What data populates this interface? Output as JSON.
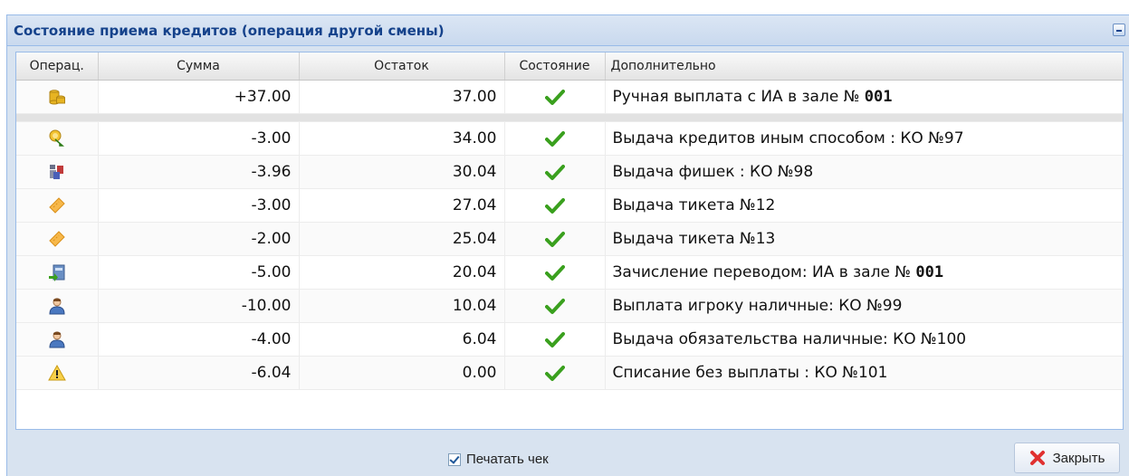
{
  "window": {
    "title": "Состояние приема кредитов (операция другой смены)"
  },
  "table": {
    "columns": {
      "op": "Операц.",
      "sum": "Сумма",
      "rest": "Остаток",
      "state": "Состояние",
      "extra": "Дополнительно"
    },
    "first_row": {
      "icon": "coins-icon",
      "sum": "+37.00",
      "rest": "37.00",
      "state": "success-check-icon",
      "extra_text": "Ручная выплата с ИА в зале № ",
      "extra_bold": "001"
    },
    "rows": [
      {
        "icon": "credit-issue-icon",
        "sum": "-3.00",
        "rest": "34.00",
        "state": "success-check-icon",
        "extra_text": "Выдача кредитов иным способом : КО №97",
        "extra_bold": ""
      },
      {
        "icon": "chips-icon",
        "sum": "-3.96",
        "rest": "30.04",
        "state": "success-check-icon",
        "extra_text": "Выдача фишек : КО №98",
        "extra_bold": ""
      },
      {
        "icon": "ticket-icon",
        "sum": "-3.00",
        "rest": "27.04",
        "state": "success-check-icon",
        "extra_text": "Выдача тикета №12",
        "extra_bold": ""
      },
      {
        "icon": "ticket-icon",
        "sum": "-2.00",
        "rest": "25.04",
        "state": "success-check-icon",
        "extra_text": "Выдача тикета №13",
        "extra_bold": ""
      },
      {
        "icon": "transfer-icon",
        "sum": "-5.00",
        "rest": "20.04",
        "state": "success-check-icon",
        "extra_text": "Зачисление переводом: ИА в зале № ",
        "extra_bold": "001"
      },
      {
        "icon": "user-icon",
        "sum": "-10.00",
        "rest": "10.04",
        "state": "success-check-icon",
        "extra_text": "Выплата игроку наличные: КО №99",
        "extra_bold": ""
      },
      {
        "icon": "user-icon",
        "sum": "-4.00",
        "rest": "6.04",
        "state": "success-check-icon",
        "extra_text": "Выдача обязательства наличные: КО №100",
        "extra_bold": ""
      },
      {
        "icon": "warning-icon",
        "sum": "-6.04",
        "rest": "0.00",
        "state": "success-check-icon",
        "extra_text": "Списание без выплаты : КО №101",
        "extra_bold": ""
      }
    ]
  },
  "footer": {
    "print_check_label": "Печатать чек",
    "print_check_checked": true,
    "close_label": "Закрыть"
  },
  "colors": {
    "header_text": "#15428b",
    "check_green": "#3aa01e",
    "close_red": "#e03131"
  }
}
